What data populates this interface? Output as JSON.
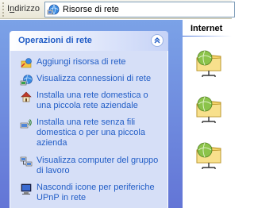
{
  "address_bar": {
    "label": "Indirizzo",
    "label_access_key": "n",
    "location": "Risorse di rete"
  },
  "task_pane": {
    "title": "Operazioni di rete",
    "items": [
      {
        "label": "Aggiungi risorsa di rete",
        "icon": "add-network-place-icon"
      },
      {
        "label": "Visualizza connessioni di rete",
        "icon": "network-connections-icon"
      },
      {
        "label": "Installa una rete domestica o una piccola rete aziendale",
        "icon": "home-network-icon"
      },
      {
        "label": "Installa una rete senza fili domestica o per una piccola azienda",
        "icon": "wireless-network-icon"
      },
      {
        "label": "Visualizza computer del gruppo di lavoro",
        "icon": "workgroup-computers-icon"
      },
      {
        "label": "Nascondi icone per periferiche UPnP in rete",
        "icon": "upnp-device-icon"
      }
    ]
  },
  "content": {
    "group_title": "Internet",
    "items": [
      {
        "icon": "network-folder-icon"
      },
      {
        "icon": "network-folder-icon"
      },
      {
        "icon": "network-folder-icon"
      }
    ]
  },
  "colors": {
    "link": "#215dc6",
    "pane_gradient_top": "#7ba2e7",
    "pane_gradient_bottom": "#6375d6",
    "task_body": "#d6dff7"
  }
}
